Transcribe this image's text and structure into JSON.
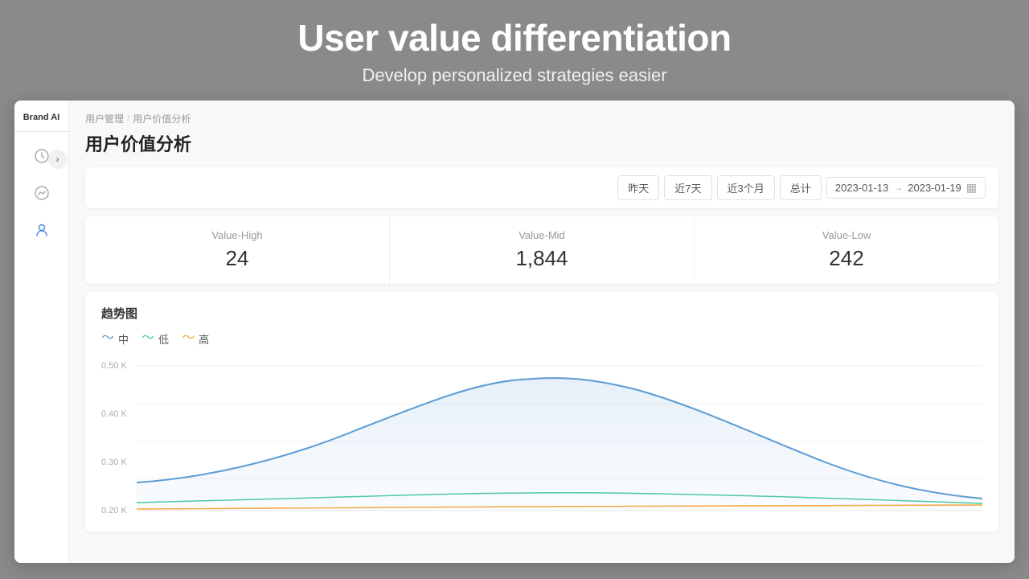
{
  "hero": {
    "title": "User value differentiation",
    "subtitle": "Develop personalized strategies easier"
  },
  "brand": {
    "name": "Brand AI"
  },
  "breadcrumb": {
    "parent": "用户管理",
    "separator": "/",
    "current": "用户价值分析"
  },
  "page": {
    "title": "用户价值分析"
  },
  "filter_buttons": [
    {
      "label": "昨天",
      "key": "yesterday"
    },
    {
      "label": "近7天",
      "key": "last7days"
    },
    {
      "label": "近3个月",
      "key": "last3months"
    },
    {
      "label": "总计",
      "key": "total"
    }
  ],
  "date_range": {
    "start": "2023-01-13",
    "arrow": "→",
    "end": "2023-01-19"
  },
  "stats": [
    {
      "label": "Value-High",
      "value": "24"
    },
    {
      "label": "Value-Mid",
      "value": "1,844"
    },
    {
      "label": "Value-Low",
      "value": "242"
    }
  ],
  "chart": {
    "title": "趋势图",
    "legend": [
      {
        "label": "中",
        "color": "#5b9bd5"
      },
      {
        "label": "低",
        "color": "#4cc9a0"
      },
      {
        "label": "高",
        "color": "#f5a742"
      }
    ],
    "y_labels": [
      "0.50 K",
      "0.40 K",
      "0.30 K",
      "0.20 K"
    ],
    "grid_lines": 4
  },
  "sidebar": {
    "icons": [
      {
        "name": "home-icon",
        "symbol": "⊙"
      },
      {
        "name": "chart-icon",
        "symbol": "◎"
      },
      {
        "name": "users-icon",
        "symbol": "👤"
      }
    ]
  }
}
